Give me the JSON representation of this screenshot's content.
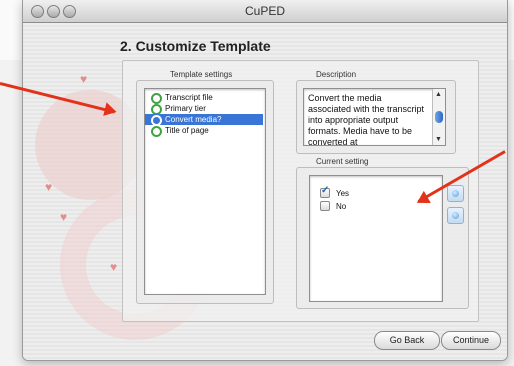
{
  "window": {
    "title": "CuPED"
  },
  "page": {
    "heading": "2. Customize Template"
  },
  "template_settings": {
    "label": "Template settings",
    "items": [
      {
        "label": "Transcript file",
        "selected": false
      },
      {
        "label": "Primary tier",
        "selected": false
      },
      {
        "label": "Convert media?",
        "selected": true
      },
      {
        "label": "Title of page",
        "selected": false
      }
    ]
  },
  "description": {
    "label": "Description",
    "text": "Convert the media associated with the transcript into appropriate output formats. Media have to be converted at"
  },
  "current_setting": {
    "label": "Current setting",
    "options": [
      {
        "label": "Yes",
        "checked": true
      },
      {
        "label": "No",
        "checked": false
      }
    ]
  },
  "buttons": {
    "back": "Go Back",
    "continue": "Continue"
  },
  "colors": {
    "selection": "#3875d7",
    "arrow": "#e2321a",
    "status_icon": "#3fa43f"
  }
}
